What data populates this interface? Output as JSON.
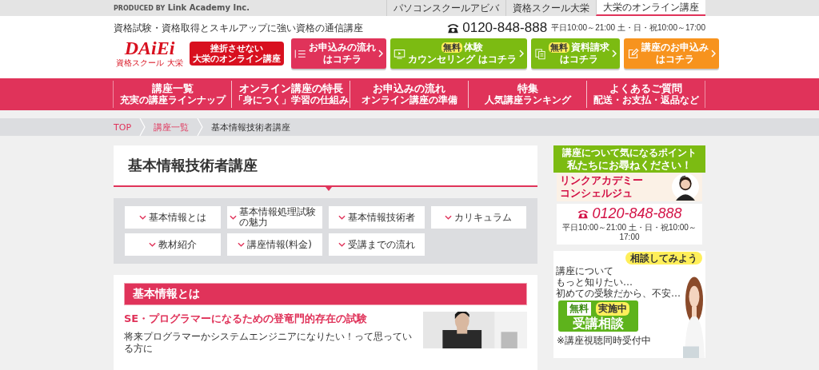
{
  "top_bar": {
    "producer_prefix": "PRODUCED BY",
    "producer": "Link Academy Inc.",
    "site_tabs": [
      {
        "label": "パソコンスクールアビバ",
        "selected": false
      },
      {
        "label": "資格スクール大栄",
        "selected": false
      },
      {
        "label": "大栄のオンライン講座",
        "selected": true
      }
    ]
  },
  "header": {
    "tagline": "資格試験・資格取得とスキルアップに強い資格の通信講座",
    "phone": "0120-848-888",
    "hours": "平日10:00～21:00 土・日・祝10:00～17:00",
    "logo": "DAiEi",
    "logo_sub": "資格スクール 大栄",
    "badge_lines": [
      "挫折させない",
      "大栄のオンライン講座"
    ],
    "cta_buttons": [
      {
        "kind": "flow",
        "color": "#e0335a",
        "title": "お申込みの流れ",
        "subtitle": "はコチラ"
      },
      {
        "kind": "trial",
        "color": "#7cbb12",
        "badge": "無料",
        "title": "体験",
        "subtitle": "カウンセリング はコチラ"
      },
      {
        "kind": "brochure",
        "color": "#7cbb12",
        "badge": "無料",
        "title": "資料請求",
        "subtitle": "はコチラ"
      },
      {
        "kind": "apply",
        "color": "#f7931e",
        "title": "講座のお申込み",
        "subtitle": "はコチラ"
      }
    ]
  },
  "nav": [
    {
      "title": "講座一覧",
      "subtitle": "充実の講座ラインナップ"
    },
    {
      "title": "オンライン講座の特長",
      "subtitle": "「身につく」学習の仕組み"
    },
    {
      "title": "お申込みの流れ",
      "subtitle": "オンライン講座の準備"
    },
    {
      "title": "特集",
      "subtitle": "人気講座ランキング"
    },
    {
      "title": "よくあるご質問",
      "subtitle": "配送・お支払・返品など"
    }
  ],
  "breadcrumb": [
    {
      "label": "TOP",
      "current": false
    },
    {
      "label": "講座一覧",
      "current": false
    },
    {
      "label": "基本情報技術者講座",
      "current": true
    }
  ],
  "page_title": "基本情報技術者講座",
  "anchors": [
    "基本情報とは",
    "基本情報処理試験の魅力",
    "基本情報技術者",
    "カリキュラム",
    "教材紹介",
    "講座情報(料金)",
    "受講までの流れ"
  ],
  "section": {
    "heading": "基本情報とは",
    "subheading": "SE・プログラマーになるための登竜門的存在の試験",
    "body": "将来プログラマーかシステムエンジニアになりたい！って思っている方に"
  },
  "sidebar": {
    "contact": {
      "ribbon_top": "講座について気になるポイント",
      "ribbon_main": "私たちにお尋ねください！",
      "name_lines": [
        "リンクアカデミー",
        "コンシェルジュ"
      ],
      "phone": "0120-848-888",
      "hours": "平日10:00～21:00 土・日・祝10:00～17:00"
    },
    "consult": {
      "bubble": "相談してみよう",
      "lines": [
        "講座について",
        "もっと知りたい…",
        "初めての受験だから、不安…"
      ],
      "free": "無料",
      "now": "実施中",
      "big": "受講相談",
      "note": "※講座視聴同時受付中"
    }
  }
}
